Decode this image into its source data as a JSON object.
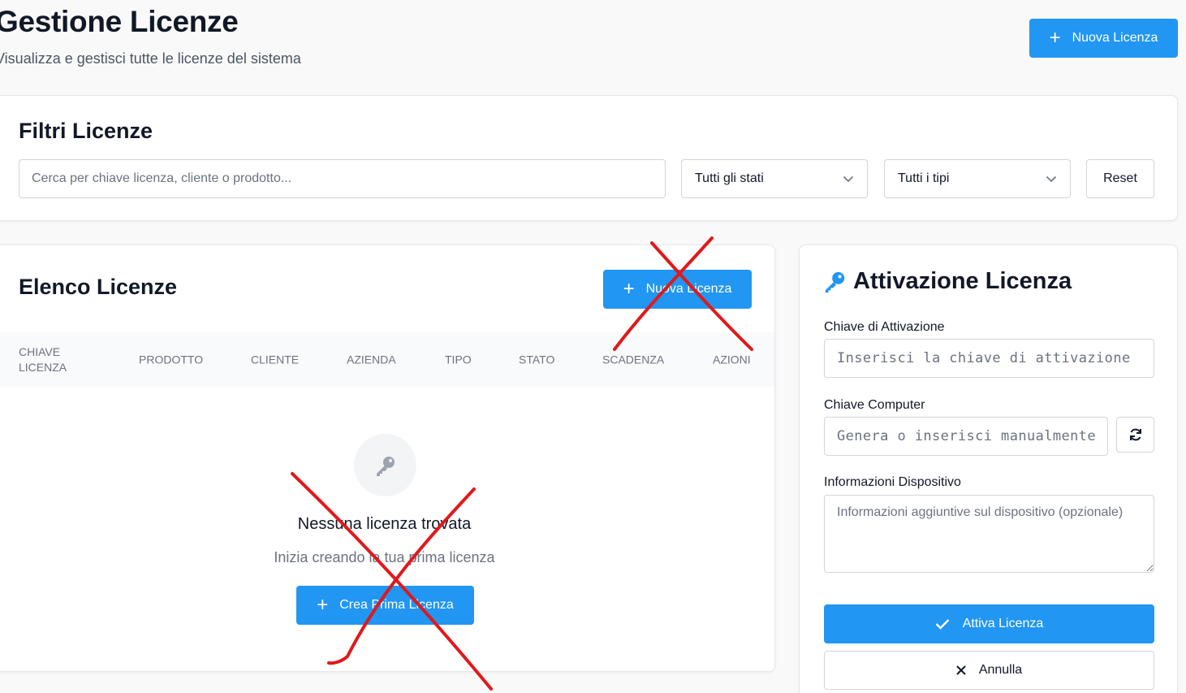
{
  "header": {
    "title": "Gestione Licenze",
    "subtitle": "Visualizza e gestisci tutte le licenze del sistema",
    "new_license_label": "Nuova Licenza"
  },
  "filters": {
    "title": "Filtri Licenze",
    "search_placeholder": "Cerca per chiave licenza, cliente o prodotto...",
    "status_selected": "Tutti gli stati",
    "type_selected": "Tutti i tipi",
    "reset_label": "Reset"
  },
  "license_list": {
    "title": "Elenco Licenze",
    "new_license_label": "Nuova Licenza",
    "columns": [
      "CHIAVE\nLICENZA",
      "PRODOTTO",
      "CLIENTE",
      "AZIENDA",
      "TIPO",
      "STATO",
      "SCADENZA",
      "AZIONI"
    ],
    "empty_title": "Nessuna licenza trovata",
    "empty_subtitle": "Inizia creando la tua prima licenza",
    "create_first_label": "Crea Prima Licenza"
  },
  "activation": {
    "title": "Attivazione Licenza",
    "activation_key_label": "Chiave di Attivazione",
    "activation_key_placeholder": "Inserisci la chiave di attivazione",
    "computer_key_label": "Chiave Computer",
    "computer_key_placeholder": "Genera o inserisci manualmente",
    "device_info_label": "Informazioni Dispositivo",
    "device_info_placeholder": "Informazioni aggiuntive sul dispositivo (opzionale)",
    "activate_label": "Attiva Licenza",
    "cancel_label": "Annulla"
  },
  "colors": {
    "primary": "#2196f3",
    "annotation_red": "#e0191b"
  },
  "icons": [
    "plus-icon",
    "chevron-down-icon",
    "key-icon",
    "refresh-icon",
    "check-icon",
    "close-icon"
  ]
}
